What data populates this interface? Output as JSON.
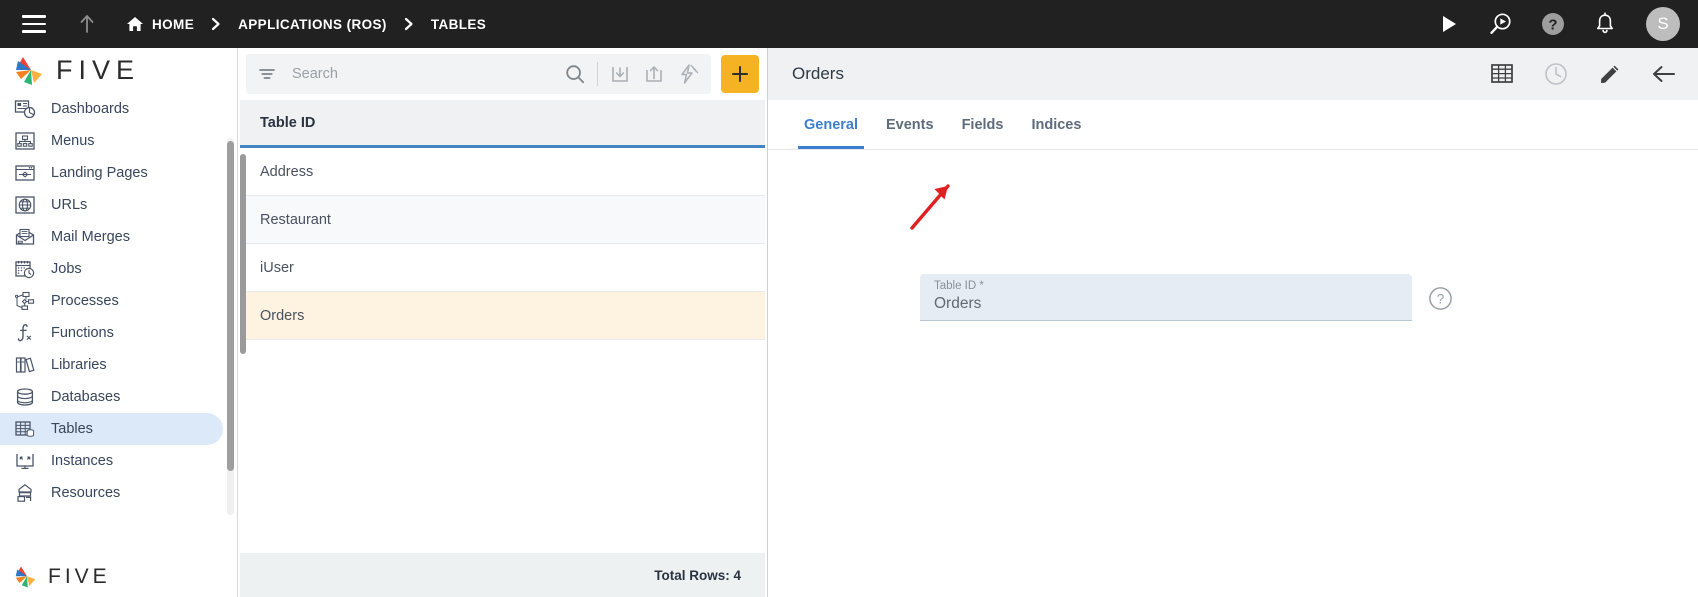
{
  "topbar": {
    "menu_icon": "hamburger-icon",
    "up_icon": "arrow-up-icon",
    "breadcrumbs": [
      {
        "label": "HOME",
        "icon": "home-icon"
      },
      {
        "label": "APPLICATIONS (ROS)",
        "icon": ""
      },
      {
        "label": "TABLES",
        "icon": ""
      }
    ],
    "separator": "›",
    "actions": [
      {
        "name": "run-icon",
        "title": "Run"
      },
      {
        "name": "preview-run-icon",
        "title": "Preview"
      },
      {
        "name": "help-icon",
        "title": "Help"
      },
      {
        "name": "notifications-bell-icon",
        "title": "Notifications"
      }
    ],
    "avatar_initial": "S",
    "accent_color": "#f5b324"
  },
  "sidebar": {
    "logo_text": "FIVE",
    "footer_logo_text": "FIVE",
    "items": [
      {
        "label": "Dashboards",
        "icon": "dashboards-icon",
        "active": false
      },
      {
        "label": "Menus",
        "icon": "menus-icon",
        "active": false
      },
      {
        "label": "Landing Pages",
        "icon": "landing-pages-icon",
        "active": false
      },
      {
        "label": "URLs",
        "icon": "urls-globe-icon",
        "active": false
      },
      {
        "label": "Mail Merges",
        "icon": "mail-merges-icon",
        "active": false
      },
      {
        "label": "Jobs",
        "icon": "jobs-calendar-clock-icon",
        "active": false
      },
      {
        "label": "Processes",
        "icon": "processes-flow-icon",
        "active": false
      },
      {
        "label": "Functions",
        "icon": "functions-integral-icon",
        "active": false
      },
      {
        "label": "Libraries",
        "icon": "libraries-books-icon",
        "active": false
      },
      {
        "label": "Databases",
        "icon": "databases-cylinder-icon",
        "active": false
      },
      {
        "label": "Tables",
        "icon": "tables-grid-icon",
        "active": true
      },
      {
        "label": "Instances",
        "icon": "instances-monitor-icon",
        "active": false
      },
      {
        "label": "Resources",
        "icon": "resources-icon",
        "active": false
      }
    ],
    "active_bg": "#dbe9f8"
  },
  "list_panel": {
    "search": {
      "placeholder": "Search",
      "value": ""
    },
    "toolbar_icons": [
      {
        "name": "filter-icon"
      },
      {
        "name": "search-icon"
      },
      {
        "name": "import-icon"
      },
      {
        "name": "export-icon"
      },
      {
        "name": "quick-action-lightning-icon"
      },
      {
        "name": "add-button",
        "label": "+"
      }
    ],
    "add_label": "+",
    "column_header": "Table ID",
    "rows": [
      {
        "name": "Address",
        "selected": false
      },
      {
        "name": "Restaurant",
        "selected": false
      },
      {
        "name": "iUser",
        "selected": false
      },
      {
        "name": "Orders",
        "selected": true
      }
    ],
    "footer_text": "Total Rows: 4",
    "header_underline_color": "#4285c5",
    "selected_row_color": "#fdf3e0"
  },
  "detail_panel": {
    "title": "Orders",
    "header_icons": [
      {
        "name": "data-grid-icon",
        "enabled": true
      },
      {
        "name": "history-clock-icon",
        "enabled": false
      },
      {
        "name": "edit-pencil-icon",
        "enabled": true
      },
      {
        "name": "back-arrow-icon",
        "enabled": true
      }
    ],
    "tabs": [
      {
        "label": "General",
        "active": true
      },
      {
        "label": "Events",
        "active": false
      },
      {
        "label": "Fields",
        "active": false
      },
      {
        "label": "Indices",
        "active": false
      }
    ],
    "active_tab_color": "#3c7fd0",
    "form": {
      "fields": [
        {
          "label": "Table ID *",
          "value": "Orders",
          "help_icon": "help-circle-icon"
        }
      ]
    },
    "annotation": {
      "type": "red-arrow",
      "points_to": "Fields",
      "color": "#e02020"
    }
  }
}
